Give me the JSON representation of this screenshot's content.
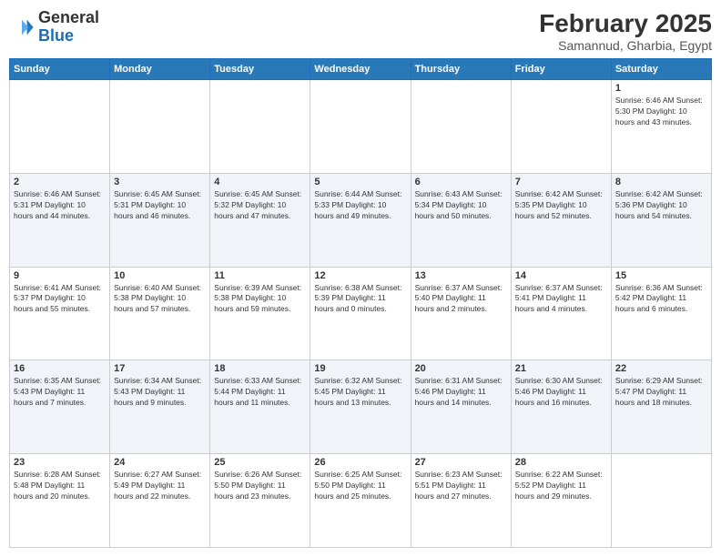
{
  "header": {
    "logo_general": "General",
    "logo_blue": "Blue",
    "month_title": "February 2025",
    "location": "Samannud, Gharbia, Egypt"
  },
  "days_of_week": [
    "Sunday",
    "Monday",
    "Tuesday",
    "Wednesday",
    "Thursday",
    "Friday",
    "Saturday"
  ],
  "weeks": [
    [
      {
        "day": "",
        "info": ""
      },
      {
        "day": "",
        "info": ""
      },
      {
        "day": "",
        "info": ""
      },
      {
        "day": "",
        "info": ""
      },
      {
        "day": "",
        "info": ""
      },
      {
        "day": "",
        "info": ""
      },
      {
        "day": "1",
        "info": "Sunrise: 6:46 AM\nSunset: 5:30 PM\nDaylight: 10 hours\nand 43 minutes."
      }
    ],
    [
      {
        "day": "2",
        "info": "Sunrise: 6:46 AM\nSunset: 5:31 PM\nDaylight: 10 hours\nand 44 minutes."
      },
      {
        "day": "3",
        "info": "Sunrise: 6:45 AM\nSunset: 5:31 PM\nDaylight: 10 hours\nand 46 minutes."
      },
      {
        "day": "4",
        "info": "Sunrise: 6:45 AM\nSunset: 5:32 PM\nDaylight: 10 hours\nand 47 minutes."
      },
      {
        "day": "5",
        "info": "Sunrise: 6:44 AM\nSunset: 5:33 PM\nDaylight: 10 hours\nand 49 minutes."
      },
      {
        "day": "6",
        "info": "Sunrise: 6:43 AM\nSunset: 5:34 PM\nDaylight: 10 hours\nand 50 minutes."
      },
      {
        "day": "7",
        "info": "Sunrise: 6:42 AM\nSunset: 5:35 PM\nDaylight: 10 hours\nand 52 minutes."
      },
      {
        "day": "8",
        "info": "Sunrise: 6:42 AM\nSunset: 5:36 PM\nDaylight: 10 hours\nand 54 minutes."
      }
    ],
    [
      {
        "day": "9",
        "info": "Sunrise: 6:41 AM\nSunset: 5:37 PM\nDaylight: 10 hours\nand 55 minutes."
      },
      {
        "day": "10",
        "info": "Sunrise: 6:40 AM\nSunset: 5:38 PM\nDaylight: 10 hours\nand 57 minutes."
      },
      {
        "day": "11",
        "info": "Sunrise: 6:39 AM\nSunset: 5:38 PM\nDaylight: 10 hours\nand 59 minutes."
      },
      {
        "day": "12",
        "info": "Sunrise: 6:38 AM\nSunset: 5:39 PM\nDaylight: 11 hours\nand 0 minutes."
      },
      {
        "day": "13",
        "info": "Sunrise: 6:37 AM\nSunset: 5:40 PM\nDaylight: 11 hours\nand 2 minutes."
      },
      {
        "day": "14",
        "info": "Sunrise: 6:37 AM\nSunset: 5:41 PM\nDaylight: 11 hours\nand 4 minutes."
      },
      {
        "day": "15",
        "info": "Sunrise: 6:36 AM\nSunset: 5:42 PM\nDaylight: 11 hours\nand 6 minutes."
      }
    ],
    [
      {
        "day": "16",
        "info": "Sunrise: 6:35 AM\nSunset: 5:43 PM\nDaylight: 11 hours\nand 7 minutes."
      },
      {
        "day": "17",
        "info": "Sunrise: 6:34 AM\nSunset: 5:43 PM\nDaylight: 11 hours\nand 9 minutes."
      },
      {
        "day": "18",
        "info": "Sunrise: 6:33 AM\nSunset: 5:44 PM\nDaylight: 11 hours\nand 11 minutes."
      },
      {
        "day": "19",
        "info": "Sunrise: 6:32 AM\nSunset: 5:45 PM\nDaylight: 11 hours\nand 13 minutes."
      },
      {
        "day": "20",
        "info": "Sunrise: 6:31 AM\nSunset: 5:46 PM\nDaylight: 11 hours\nand 14 minutes."
      },
      {
        "day": "21",
        "info": "Sunrise: 6:30 AM\nSunset: 5:46 PM\nDaylight: 11 hours\nand 16 minutes."
      },
      {
        "day": "22",
        "info": "Sunrise: 6:29 AM\nSunset: 5:47 PM\nDaylight: 11 hours\nand 18 minutes."
      }
    ],
    [
      {
        "day": "23",
        "info": "Sunrise: 6:28 AM\nSunset: 5:48 PM\nDaylight: 11 hours\nand 20 minutes."
      },
      {
        "day": "24",
        "info": "Sunrise: 6:27 AM\nSunset: 5:49 PM\nDaylight: 11 hours\nand 22 minutes."
      },
      {
        "day": "25",
        "info": "Sunrise: 6:26 AM\nSunset: 5:50 PM\nDaylight: 11 hours\nand 23 minutes."
      },
      {
        "day": "26",
        "info": "Sunrise: 6:25 AM\nSunset: 5:50 PM\nDaylight: 11 hours\nand 25 minutes."
      },
      {
        "day": "27",
        "info": "Sunrise: 6:23 AM\nSunset: 5:51 PM\nDaylight: 11 hours\nand 27 minutes."
      },
      {
        "day": "28",
        "info": "Sunrise: 6:22 AM\nSunset: 5:52 PM\nDaylight: 11 hours\nand 29 minutes."
      },
      {
        "day": "",
        "info": ""
      }
    ]
  ]
}
